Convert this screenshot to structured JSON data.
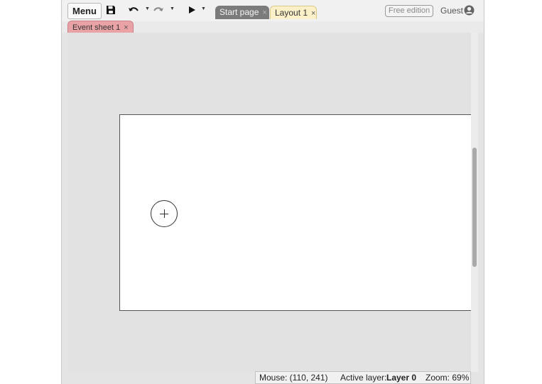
{
  "toolbar": {
    "menu_label": "Menu",
    "icons": [
      "save-icon",
      "undo-icon",
      "redo-icon",
      "play-icon"
    ]
  },
  "tabs": [
    {
      "label": "Start page",
      "close": "×",
      "active": false
    },
    {
      "label": "Layout 1",
      "close": "×",
      "active": true
    }
  ],
  "subtabs": [
    {
      "label": "Event sheet 1",
      "close": "×"
    }
  ],
  "header_right": {
    "edition_badge": "Free edition",
    "user_label": "Guest"
  },
  "status": {
    "mouse": "Mouse: (110, 241)",
    "active_layer_label": "Active layer:",
    "active_layer_value": "Layer 0",
    "zoom": "Zoom: 69%"
  },
  "colors": {
    "tab_active": "#fbf0c8",
    "tab_inactive": "#7b7b7b",
    "event_tab": "#e9a3a7",
    "workspace": "#e2e2e2"
  }
}
